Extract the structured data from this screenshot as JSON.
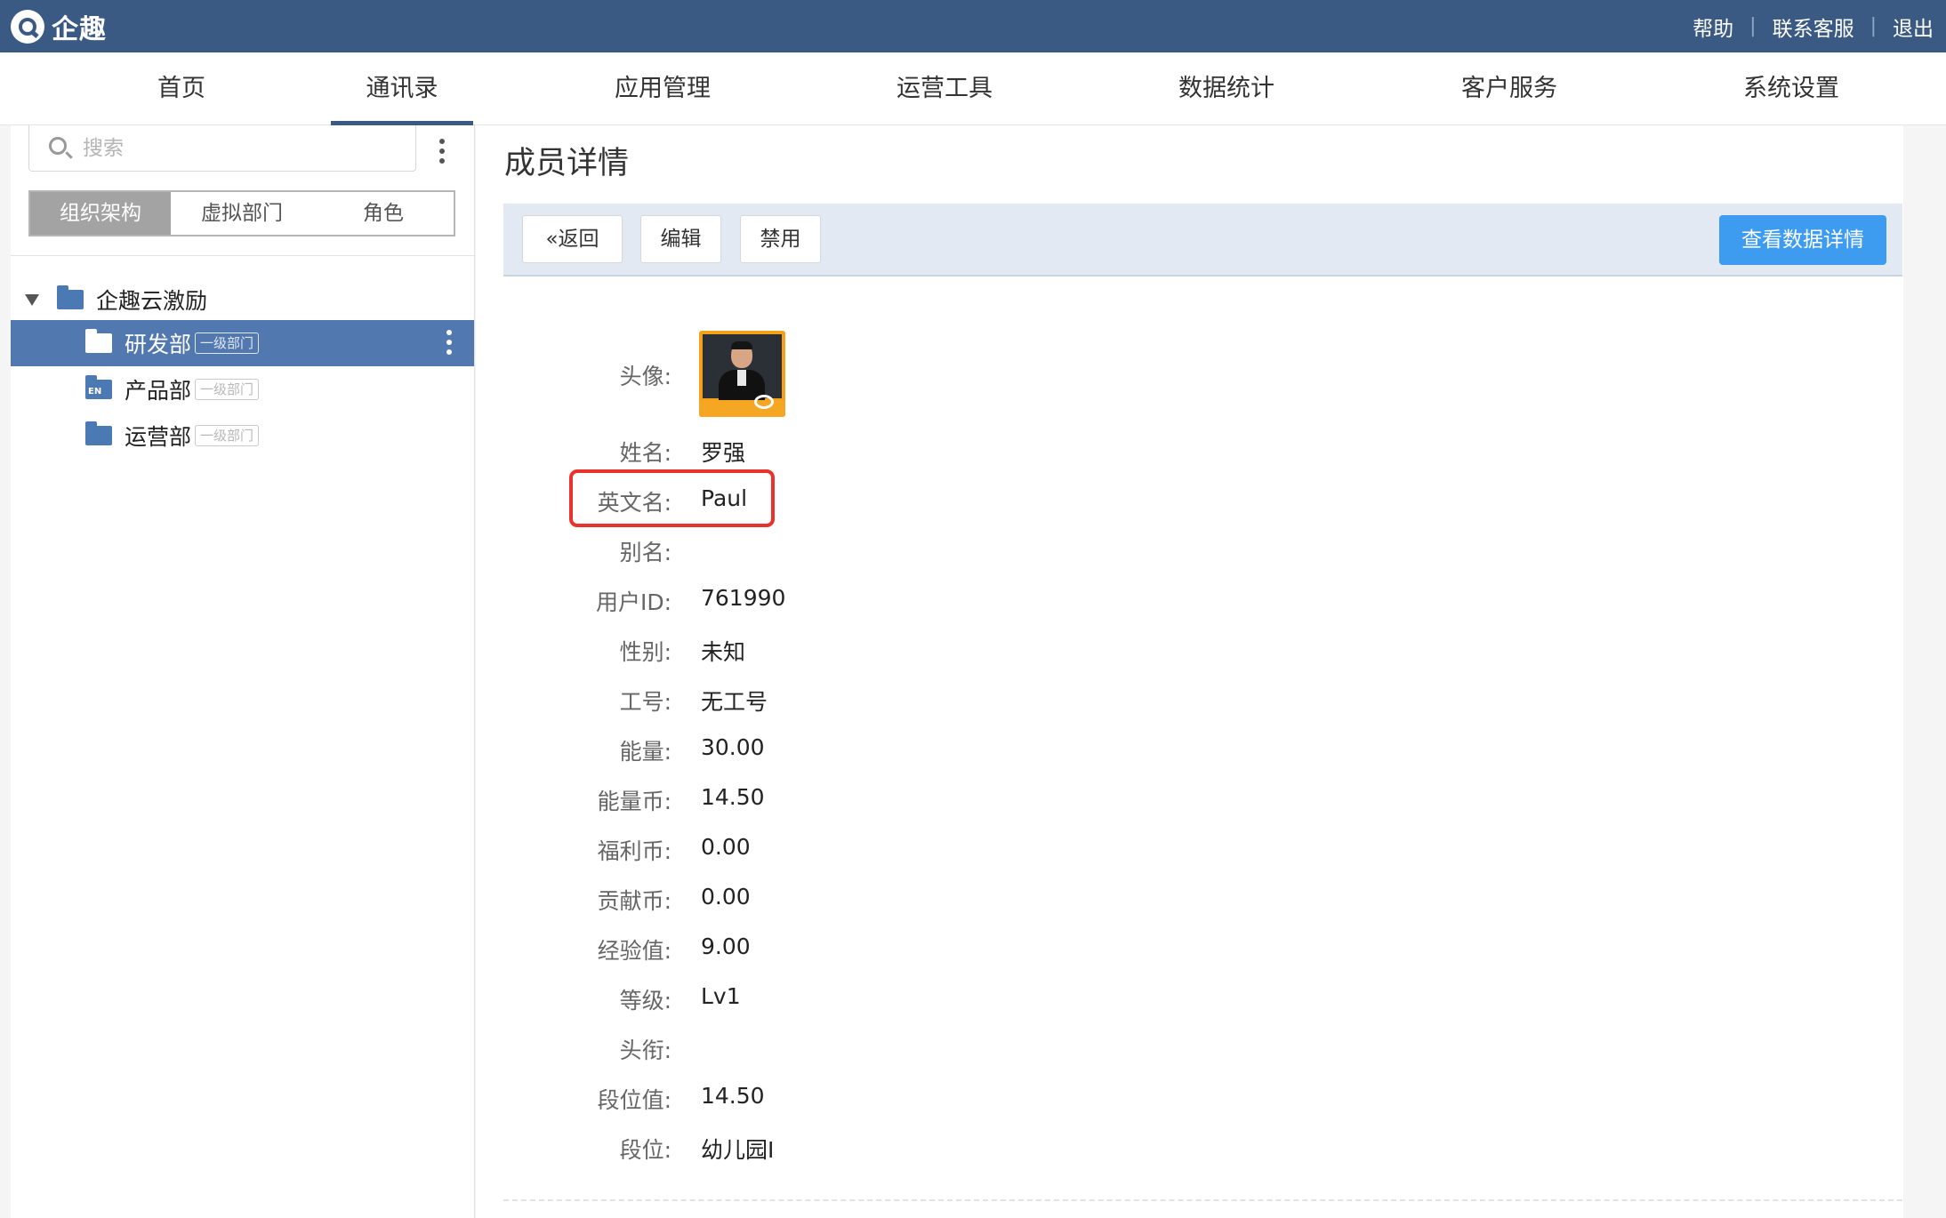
{
  "app": {
    "name": "企趣"
  },
  "header_links": [
    "帮助",
    "联系客服",
    "退出"
  ],
  "nav": [
    "首页",
    "通讯录",
    "应用管理",
    "运营工具",
    "数据统计",
    "客户服务",
    "系统设置"
  ],
  "nav_active": "通讯录",
  "sidebar": {
    "search_placeholder": "搜索",
    "segments": [
      "组织架构",
      "虚拟部门",
      "角色"
    ],
    "segment_active": "组织架构",
    "root": "企趣云激励",
    "departments": [
      {
        "name": "研发部",
        "tag": "一级部门",
        "selected": true
      },
      {
        "name": "产品部",
        "tag": "一级部门",
        "icon_text": "EN"
      },
      {
        "name": "运营部",
        "tag": "一级部门"
      }
    ]
  },
  "content": {
    "title": "成员详情",
    "buttons": {
      "back": "«返回",
      "edit": "编辑",
      "disable": "禁用",
      "view_data": "查看数据详情"
    },
    "fields": [
      {
        "label": "头像:",
        "value": ""
      },
      {
        "label": "姓名:",
        "value": "罗强"
      },
      {
        "label": "英文名:",
        "value": "Paul"
      },
      {
        "label": "别名:",
        "value": ""
      },
      {
        "label": "用户ID:",
        "value": "761990"
      },
      {
        "label": "性别:",
        "value": "未知"
      },
      {
        "label": "工号:",
        "value": "无工号"
      },
      {
        "label": "能量:",
        "value": "30.00"
      },
      {
        "label": "能量币:",
        "value": "14.50"
      },
      {
        "label": "福利币:",
        "value": "0.00"
      },
      {
        "label": "贡献币:",
        "value": "0.00"
      },
      {
        "label": "经验值:",
        "value": "9.00"
      },
      {
        "label": "等级:",
        "value": "Lv1"
      },
      {
        "label": "头衔:",
        "value": ""
      },
      {
        "label": "段位值:",
        "value": "14.50"
      },
      {
        "label": "段位:",
        "value": "幼儿园I"
      }
    ]
  },
  "colors": {
    "header": "#3a5a84",
    "selected": "#5278b0",
    "primary": "#3d9cf0",
    "highlight": "#e8322b"
  }
}
